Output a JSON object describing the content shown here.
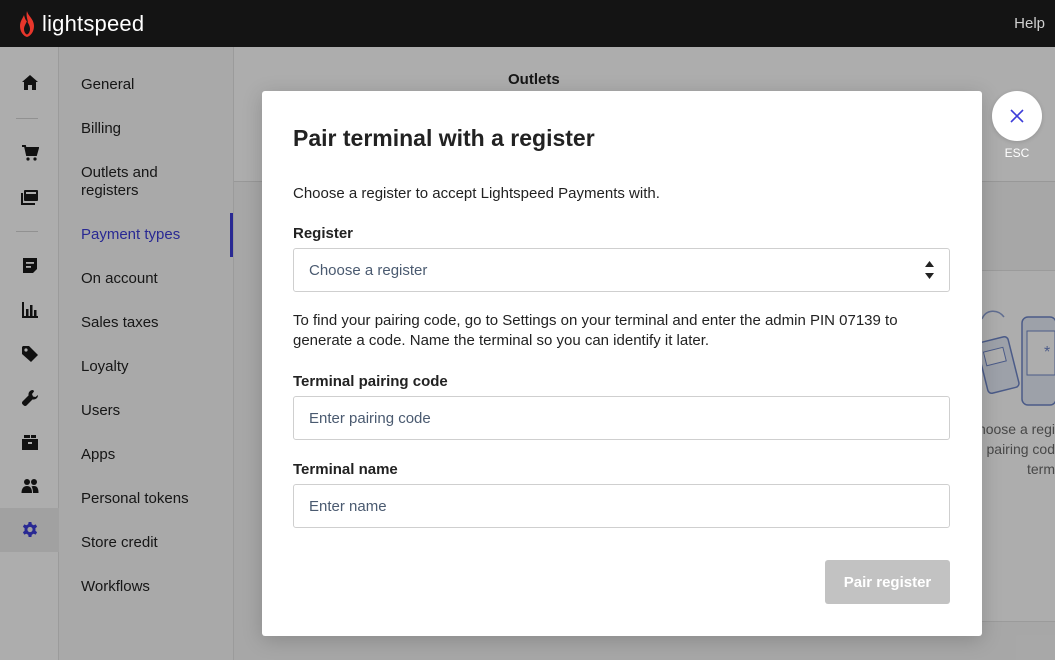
{
  "brand": {
    "name": "lightspeed",
    "accent": "#3d3dd9",
    "logo_color": "#e8362b"
  },
  "topbar": {
    "help_label": "Help"
  },
  "rail": {
    "items": [
      {
        "icon": "home-icon"
      },
      {
        "icon": "cart-icon"
      },
      {
        "icon": "register-icon"
      },
      {
        "icon": "receipt-icon"
      },
      {
        "icon": "chart-icon"
      },
      {
        "icon": "tag-icon"
      },
      {
        "icon": "wrench-icon"
      },
      {
        "icon": "stack-icon"
      },
      {
        "icon": "users-icon"
      },
      {
        "icon": "gear-icon",
        "active": true
      }
    ]
  },
  "subnav": {
    "items": [
      {
        "label": "General"
      },
      {
        "label": "Billing"
      },
      {
        "label": "Outlets and registers"
      },
      {
        "label": "Payment types",
        "active": true
      },
      {
        "label": "On account"
      },
      {
        "label": "Sales taxes"
      },
      {
        "label": "Loyalty"
      },
      {
        "label": "Users"
      },
      {
        "label": "Apps"
      },
      {
        "label": "Personal tokens"
      },
      {
        "label": "Store credit"
      },
      {
        "label": "Workflows"
      }
    ]
  },
  "background": {
    "outlets_heading": "Outlets",
    "card_text_lines": [
      "hoose a regi",
      "e pairing cod",
      "term"
    ]
  },
  "modal": {
    "title": "Pair terminal with a register",
    "description": "Choose a register to accept Lightspeed Payments with.",
    "register_label": "Register",
    "register_placeholder": "Choose a register",
    "help_text": "To find your pairing code, go to Settings on your terminal and enter the admin PIN 07139 to generate a code. Name the terminal so you can identify it later.",
    "pairing_code_label": "Terminal pairing code",
    "pairing_code_placeholder": "Enter pairing code",
    "terminal_name_label": "Terminal name",
    "terminal_name_placeholder": "Enter name",
    "pair_button_label": "Pair register"
  },
  "close": {
    "esc_label": "ESC"
  }
}
